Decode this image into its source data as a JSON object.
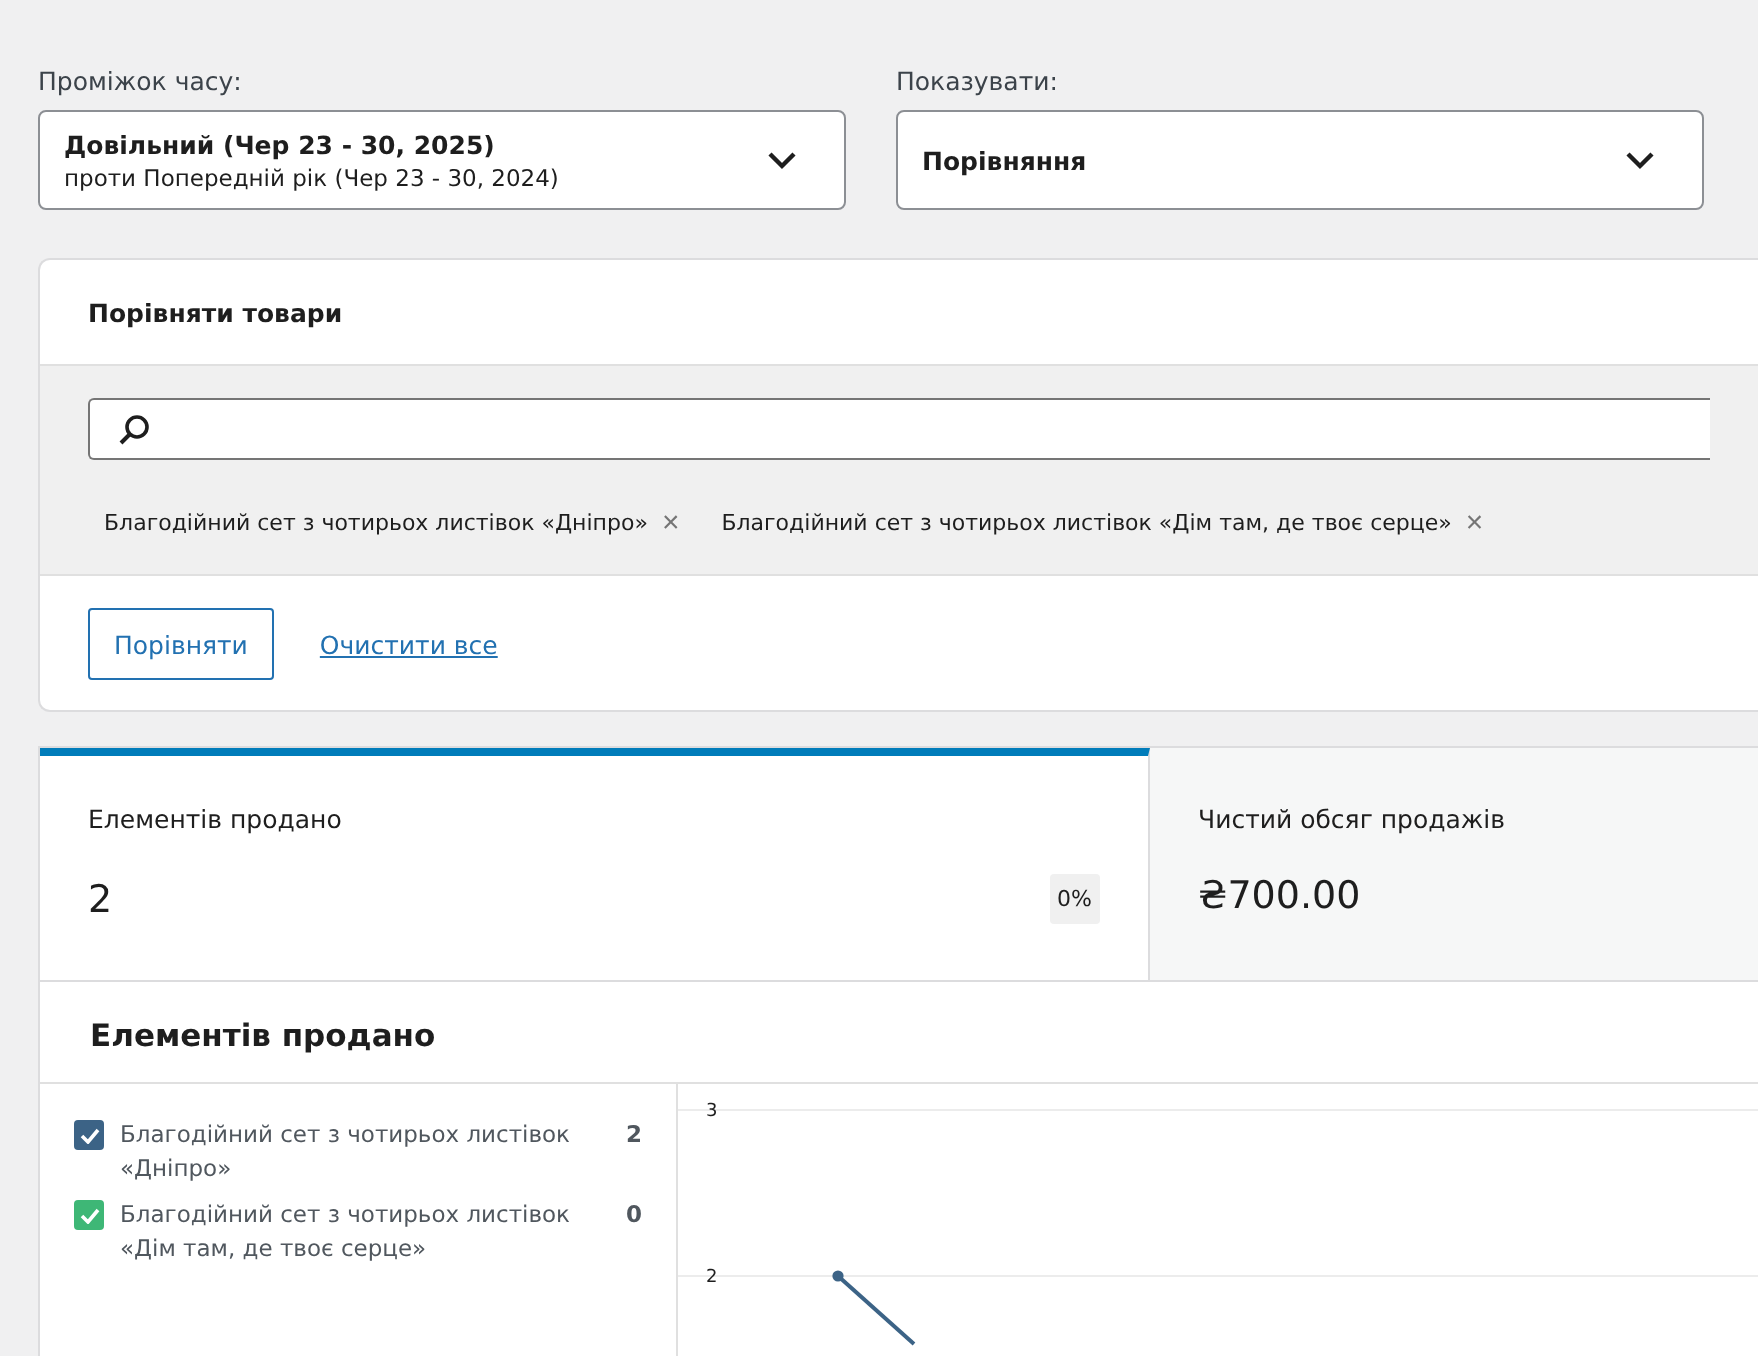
{
  "filters": [
    {
      "label": "Проміжок часу:",
      "value": "Довільний (Чер 23 - 30, 2025)",
      "subvalue": "проти Попередній рік (Чер 23 - 30, 2024)"
    },
    {
      "label": "Показувати:",
      "value": "Порівняння"
    }
  ],
  "compare": {
    "title": "Порівняти товари",
    "chips": [
      {
        "label": "Благодійний сет з чотирьох листівок «Дніпро»",
        "remove": "×"
      },
      {
        "label": "Благодійний сет з чотирьох листівок «Дім там, де твоє серце»",
        "remove": "×"
      }
    ],
    "compare_button": "Порівняти",
    "clear_link": "Очистити все"
  },
  "summary": [
    {
      "label": "Елементів продано",
      "value": "2",
      "delta": "0%",
      "selected": true
    },
    {
      "label": "Чистий обсяг продажів",
      "value": "₴700.00",
      "selected": false
    }
  ],
  "chart_card": {
    "title": "Елементів продано",
    "legend": [
      {
        "label": "Благодійний сет з чотирьох листівок «Дніпро»",
        "total": "2",
        "checked": true,
        "color": "#3c6386"
      },
      {
        "label": "Благодійний сет з чотирьох листівок «Дім там, де твоє серце»",
        "total": "0",
        "checked": true,
        "color": "#3eb776"
      }
    ],
    "chart": {
      "y_ticks": [
        "3",
        "2"
      ]
    }
  }
}
